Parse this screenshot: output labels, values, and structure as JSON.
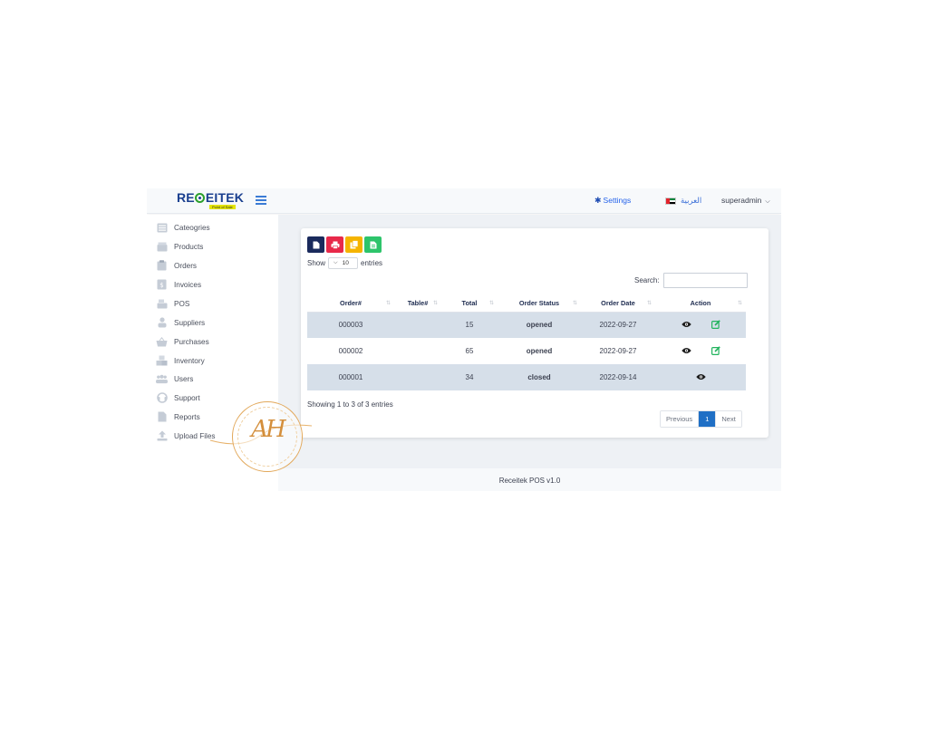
{
  "brand": {
    "name_pre": "RE",
    "name_post": "EITEK",
    "tagline": "Point of Sale"
  },
  "navbar": {
    "settings_label": "Settings",
    "language_label": "العربية",
    "user_label": "superadmin"
  },
  "sidebar": {
    "items": [
      {
        "label": "Cateogries",
        "icon": "list-icon"
      },
      {
        "label": "Products",
        "icon": "box-icon"
      },
      {
        "label": "Orders",
        "icon": "clipboard-icon"
      },
      {
        "label": "Invoices",
        "icon": "invoice-icon"
      },
      {
        "label": "POS",
        "icon": "cash-register-icon"
      },
      {
        "label": "Suppliers",
        "icon": "supplier-icon"
      },
      {
        "label": "Purchases",
        "icon": "basket-icon"
      },
      {
        "label": "Inventory",
        "icon": "boxes-icon"
      },
      {
        "label": "Users",
        "icon": "users-icon"
      },
      {
        "label": "Support",
        "icon": "headset-icon"
      },
      {
        "label": "Reports",
        "icon": "file-icon"
      },
      {
        "label": "Upload Files",
        "icon": "upload-icon"
      }
    ]
  },
  "toolbar": {
    "export_buttons": [
      {
        "name": "csv-export",
        "icon": "file-icon",
        "color": "#1a2a5c"
      },
      {
        "name": "print-export",
        "icon": "print-icon",
        "color": "#e8294a"
      },
      {
        "name": "copy-export",
        "icon": "copy-icon",
        "color": "#f5b400"
      },
      {
        "name": "excel-export",
        "icon": "excel-icon",
        "color": "#2dc46b"
      }
    ],
    "show_label": "Show",
    "page_length": "10",
    "entries_label": "entries",
    "search_label": "Search:",
    "search_value": ""
  },
  "table": {
    "columns": [
      "Order#",
      "Table#",
      "Total",
      "Order Status",
      "Order Date",
      "Action"
    ],
    "rows": [
      {
        "order": "000003",
        "table": "",
        "total": "15",
        "status": "opened",
        "date": "2022-09-27",
        "editable": true
      },
      {
        "order": "000002",
        "table": "",
        "total": "65",
        "status": "opened",
        "date": "2022-09-27",
        "editable": true
      },
      {
        "order": "000001",
        "table": "",
        "total": "34",
        "status": "closed",
        "date": "2022-09-14",
        "editable": false
      }
    ],
    "status_colors": {
      "opened": "#22c55e",
      "closed": "#2563eb"
    }
  },
  "pagination": {
    "info": "Showing 1 to 3 of 3 entries",
    "previous_label": "Previous",
    "current_page": "1",
    "next_label": "Next"
  },
  "footer": {
    "text": "Receitek POS v1.0"
  },
  "watermark": {
    "monogram": "AH"
  },
  "colors": {
    "accent": "#1f6fc5",
    "brand_blue": "#1a3f8f",
    "row_shade": "#d6dfe9"
  }
}
